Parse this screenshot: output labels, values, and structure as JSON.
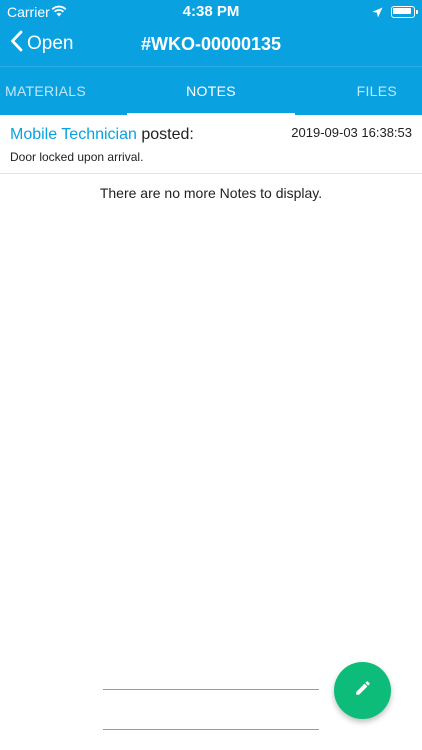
{
  "status_bar": {
    "carrier": "Carrier",
    "time": "4:38 PM"
  },
  "navbar": {
    "back_label": "Open",
    "title": "#WKO-00000135"
  },
  "tabs": [
    {
      "label": "MATERIALS",
      "active": false
    },
    {
      "label": "NOTES",
      "active": true
    },
    {
      "label": "FILES",
      "active": false
    }
  ],
  "notes": [
    {
      "author": "Mobile Technician",
      "action": "posted:",
      "timestamp": "2019-09-03 16:38:53",
      "body": "Door locked upon arrival."
    }
  ],
  "empty_message": "There are no more Notes to display.",
  "colors": {
    "header": "#0aa1e0",
    "fab": "#0dbc79",
    "author_link": "#0aa1e0"
  },
  "icons": {
    "fab": "pencil-icon",
    "back": "chevron-left-icon"
  }
}
